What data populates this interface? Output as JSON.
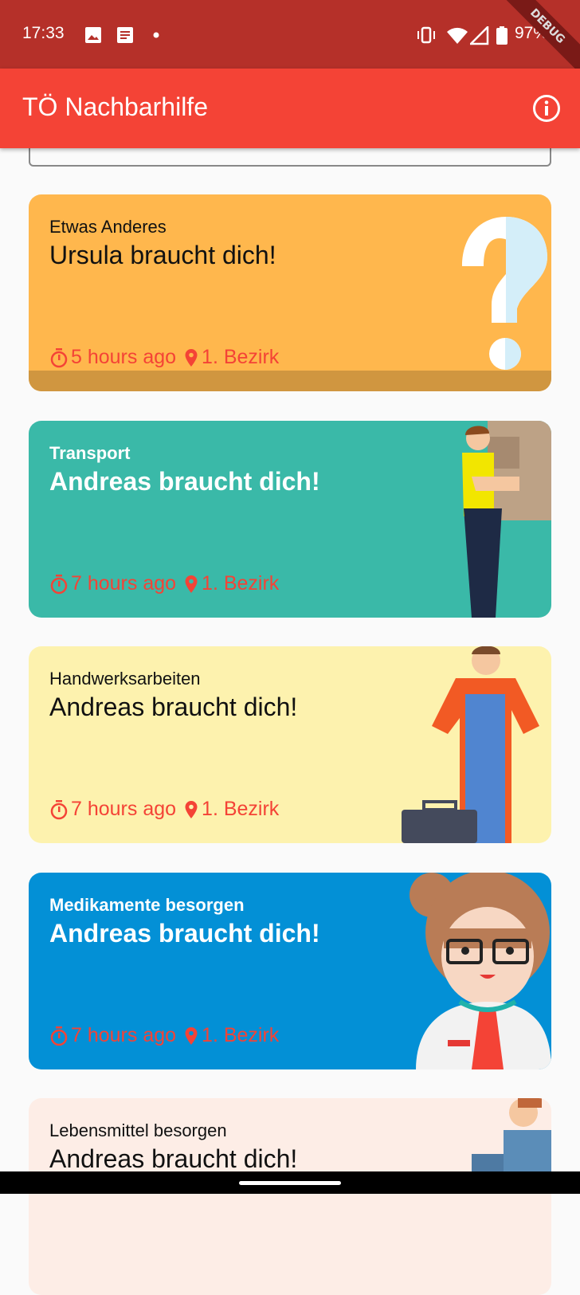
{
  "status_bar": {
    "time": "17:33",
    "battery": "97%",
    "debug_banner": "DEBUG",
    "icons": [
      "image-icon",
      "notes-icon",
      "dot-icon",
      "vibrate-icon",
      "wifi-icon",
      "signal-icon",
      "battery-icon"
    ]
  },
  "app_bar": {
    "title": "TÖ Nachbarhilfe",
    "info_icon": "info-icon"
  },
  "colors": {
    "status": "#b53029",
    "app_bar": "#f44336",
    "meta_text": "#f44336"
  },
  "cards": [
    {
      "category": "Etwas Anderes",
      "title": "Ursula braucht dich!",
      "time": "5 hours ago",
      "location": "1. Bezirk",
      "color": "#ffb74d"
    },
    {
      "category": "Transport",
      "title": "Andreas braucht dich!",
      "time": "7 hours ago",
      "location": "1. Bezirk",
      "color": "#3ab9a8"
    },
    {
      "category": "Handwerksarbeiten",
      "title": "Andreas braucht dich!",
      "time": "7 hours ago",
      "location": "1. Bezirk",
      "color": "#fdf2ae"
    },
    {
      "category": "Medikamente besorgen",
      "title": "Andreas braucht dich!",
      "time": "7 hours ago",
      "location": "1. Bezirk",
      "color": "#0390d6"
    },
    {
      "category": "Lebensmittel besorgen",
      "title": "Andreas braucht dich!",
      "time": "",
      "location": "",
      "color": "#fdede6"
    }
  ]
}
